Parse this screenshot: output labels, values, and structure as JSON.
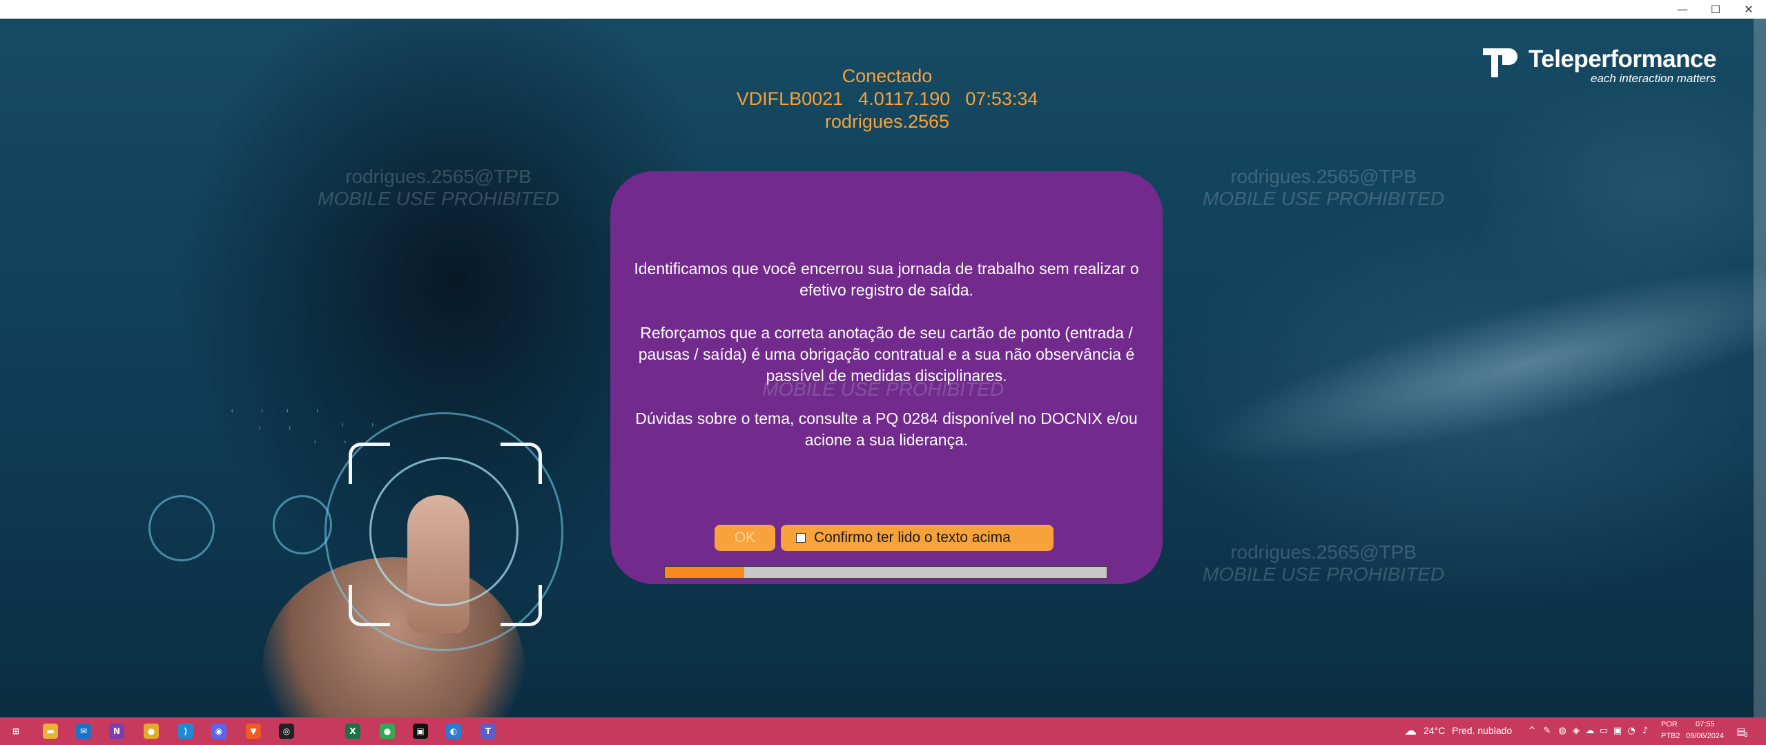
{
  "window": {
    "controls": {
      "minimize": "—",
      "maximize": "☐",
      "close": "✕"
    }
  },
  "status": {
    "line1": "Conectado",
    "machine": "VDIFLB0021",
    "version": "4.0117.190",
    "time": "07:53:34",
    "user": "rodrigues.2565"
  },
  "logo": {
    "brand": "Teleperformance",
    "tagline": "each interaction matters"
  },
  "watermarks": [
    {
      "line1": "rodrigues.2565@TPB",
      "line2": "MOBILE USE PROHIBITED"
    },
    {
      "line1": "rodrigues.2565@TPB",
      "line2": "MOBILE USE PROHIBITED"
    },
    {
      "line1": "rodrigues.2565@TPB",
      "line2": "MOBILE USE PROHIBITED"
    },
    {
      "line1": "",
      "line2": "MOBILE USE PROHIBITED"
    }
  ],
  "dialog": {
    "paragraph1": "Identificamos que você encerrou sua jornada de trabalho sem realizar o efetivo registro de saída.",
    "paragraph2": "Reforçamos que a correta anotação de seu cartão de ponto (entrada / pausas / saída) é uma obrigação contratual e a sua não observância é passível de medidas disciplinares.",
    "paragraph3": "Dúvidas sobre o tema, consulte a PQ 0284 disponível no DOCNIX e/ou acione a sua liderança.",
    "ok_label": "OK",
    "confirm_label": "Confirmo ter lido o texto acima",
    "confirm_checked": false,
    "progress_fraction": 0.18,
    "colors": {
      "dialog_bg": "#722a8c",
      "button": "#f7a23a",
      "progress_fill": "#f7891e"
    }
  },
  "taskbar": {
    "color": "#c8395e",
    "apps": [
      {
        "icon": "windows-start-icon",
        "glyph": "⊞",
        "color": "#c8395e"
      },
      {
        "icon": "file-explorer-icon",
        "glyph": "▬",
        "color": "#e8b437"
      },
      {
        "icon": "mail-icon",
        "glyph": "✉",
        "color": "#1a73c7"
      },
      {
        "icon": "onenote-icon",
        "glyph": "N",
        "color": "#7b3fb0"
      },
      {
        "icon": "chrome-icon",
        "glyph": "●",
        "color": "#e4a92b"
      },
      {
        "icon": "vscode-icon",
        "glyph": "⟩",
        "color": "#1f8ad2"
      },
      {
        "icon": "discord-icon",
        "glyph": "◉",
        "color": "#5865f2"
      },
      {
        "icon": "brave-icon",
        "glyph": "▼",
        "color": "#f05a24"
      },
      {
        "icon": "app-icon",
        "glyph": "◎",
        "color": "#222222"
      },
      {
        "icon": "blank-icon",
        "glyph": "",
        "color": "#c8395e"
      },
      {
        "icon": "excel-icon",
        "glyph": "X",
        "color": "#1d7044"
      },
      {
        "icon": "chrome-alt-icon",
        "glyph": "●",
        "color": "#34a853"
      },
      {
        "icon": "terminal-icon",
        "glyph": "▣",
        "color": "#111111"
      },
      {
        "icon": "edge-icon",
        "glyph": "◐",
        "color": "#2b7bd0"
      },
      {
        "icon": "teams-icon",
        "glyph": "T",
        "color": "#5b5fc7"
      }
    ],
    "weather": {
      "temp": "24°C",
      "desc": "Pred. nublado"
    },
    "lang": {
      "line1": "POR",
      "line2": "PTB2"
    },
    "clock": {
      "time": "07:55",
      "date": "09/06/2024"
    },
    "notification_count": "3"
  }
}
